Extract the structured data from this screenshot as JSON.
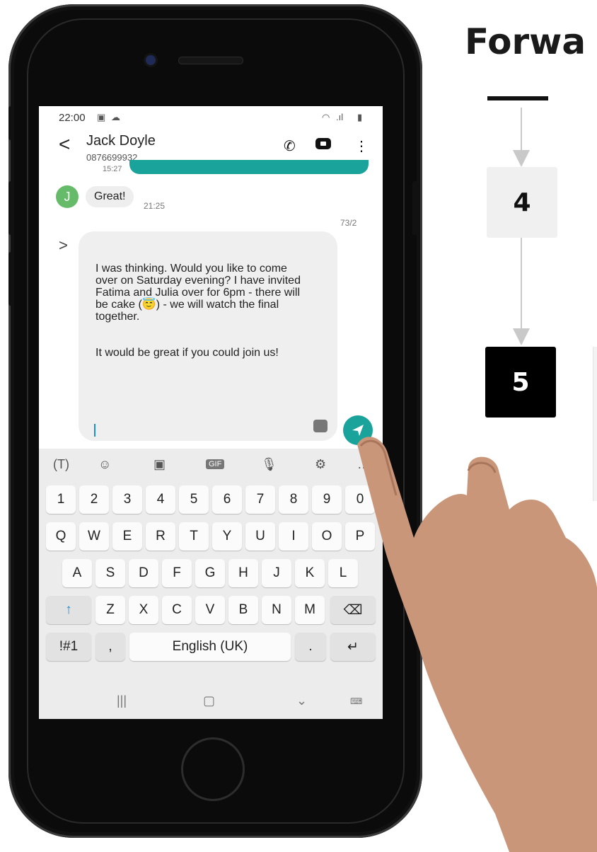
{
  "tutorial": {
    "title": "Forwa",
    "steps": [
      {
        "label": "4"
      },
      {
        "label": "5"
      }
    ]
  },
  "status": {
    "time": "22:00"
  },
  "conversation": {
    "back": "<",
    "contact_name": "Jack Doyle",
    "contact_number": "0876699932",
    "prev_time": "15:27",
    "avatar_letter": "J",
    "incoming_text": "Great!",
    "incoming_time": "21:25",
    "char_counter": "73/2",
    "expand": ">"
  },
  "compose": {
    "text": "I was thinking. Would you like to come over on Saturday evening? I have invited Fatima and Julia over for 6pm - there will be cake (😇) - we will watch the final together.\n\n\nIt would be great if you could join us!"
  },
  "keyboard": {
    "number_row": [
      "1",
      "2",
      "3",
      "4",
      "5",
      "6",
      "7",
      "8",
      "9",
      "0"
    ],
    "row1": [
      "Q",
      "W",
      "E",
      "R",
      "T",
      "Y",
      "U",
      "I",
      "O",
      "P"
    ],
    "row2": [
      "A",
      "S",
      "D",
      "F",
      "G",
      "H",
      "J",
      "K",
      "L"
    ],
    "row3": [
      "Z",
      "X",
      "C",
      "V",
      "B",
      "N",
      "M"
    ],
    "symbols": "!#1",
    "comma": ",",
    "space": "English (UK)",
    "period": ".",
    "gif": "GIF"
  },
  "colors": {
    "accent": "#1aa39a",
    "keyboard_bg": "#ececec",
    "caret": "#1a8cd8"
  }
}
